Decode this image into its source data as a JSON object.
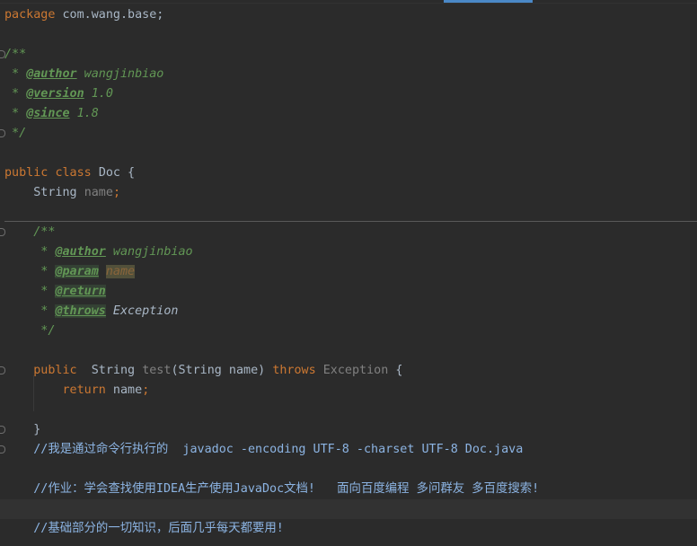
{
  "editor": {
    "lines": {
      "package": {
        "kw": "package",
        "text": " com.wang.base;"
      },
      "doc_open": {
        "text": "/**"
      },
      "author": {
        "prefix": " * ",
        "tag": "@author",
        "value": " wangjinbiao"
      },
      "version": {
        "prefix": " * ",
        "tag": "@version",
        "value": " 1.0"
      },
      "since": {
        "prefix": " * ",
        "tag": "@since",
        "value": " 1.8"
      },
      "doc_close": {
        "text": " */"
      },
      "class_decl": {
        "kw1": "public",
        "kw2": "class",
        "name": "Doc",
        "brace": " {"
      },
      "field": {
        "type": "    String ",
        "name": "name",
        "semi": ";"
      },
      "mdoc_open": {
        "text": "    /**"
      },
      "mauthor": {
        "prefix": "     * ",
        "tag": "@author",
        "value": " wangjinbiao"
      },
      "mparam": {
        "prefix": "     * ",
        "tag": "@param",
        "space": " ",
        "value": "name"
      },
      "mreturn": {
        "prefix": "     * ",
        "tag": "@return"
      },
      "mthrows": {
        "prefix": "     * ",
        "tag": "@throws",
        "value": " Exception"
      },
      "mdoc_close": {
        "text": "     */"
      },
      "method_decl": {
        "kw": "    public",
        "type": "  String ",
        "name": "test",
        "params": "(String name) ",
        "throws": "throws",
        "exception": " Exception",
        "brace": " {"
      },
      "return_stmt": {
        "kw": "        return",
        "value": " name",
        "semi": ";"
      },
      "close_brace": {
        "text": "    }"
      },
      "comment1": {
        "text": "    //我是通过命令行执行的  javadoc -encoding UTF-8 -charset UTF-8 Doc.java"
      },
      "comment2": {
        "text": "    //作业：学会查找使用IDEA生产使用JavaDoc文档!   面向百度编程 多问群友 多百度搜索!"
      },
      "comment3": {
        "text": "    //基础部分的一切知识，后面几乎每天都要用!"
      }
    }
  },
  "colors": {
    "background": "#2b2b2b",
    "keyword": "#cc7832",
    "doc_comment": "#629755",
    "field": "#9876aa",
    "comment": "#8cb4e3",
    "text": "#a9b7c6"
  }
}
